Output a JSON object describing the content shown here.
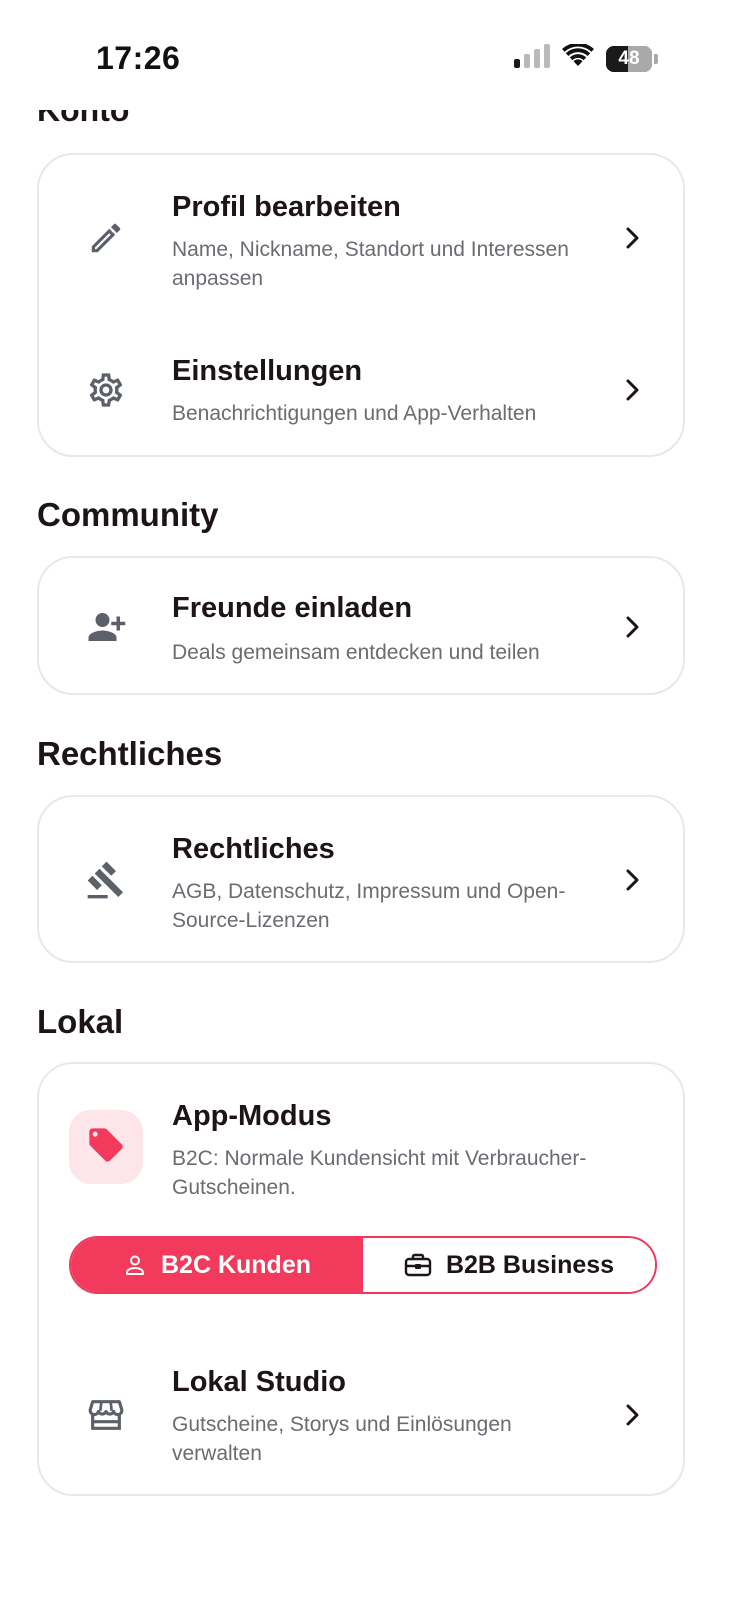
{
  "status_bar": {
    "time": "17:26",
    "battery": "48",
    "icons": [
      "signal-icon",
      "wifi-icon",
      "battery-icon"
    ]
  },
  "colors": {
    "accent": "#f23b5c",
    "accent_soft": "#fde5e9",
    "text_primary": "#1c1416",
    "text_secondary": "#6b6b72",
    "icon_gray": "#5c6068",
    "card_border": "#e8e8ea"
  },
  "konto": {
    "heading_cut": "Konto",
    "items": [
      {
        "icon": "pencil-icon",
        "title": "Profil bearbeiten",
        "subtitle": "Name, Nickname, Standort und Interessen anpassen"
      },
      {
        "icon": "gear-icon",
        "title": "Einstellungen",
        "subtitle": "Benachrichtigungen und App-Verhalten"
      }
    ]
  },
  "community": {
    "heading": "Community",
    "items": [
      {
        "icon": "person-add-icon",
        "title": "Freunde einladen",
        "subtitle": "Deals gemeinsam entdecken und teilen"
      }
    ]
  },
  "rechtliches": {
    "heading": "Rechtliches",
    "items": [
      {
        "icon": "gavel-icon",
        "title": "Rechtliches",
        "subtitle": "AGB, Datenschutz, Impressum und Open-Source-Lizenzen"
      }
    ]
  },
  "lokal": {
    "heading": "Lokal",
    "app_mode": {
      "icon": "tag-icon",
      "title": "App-Modus",
      "subtitle": "B2C: Normale Kundensicht mit Verbraucher-Gutscheinen.",
      "options": [
        {
          "icon": "person-icon",
          "label": "B2C Kunden",
          "selected": true
        },
        {
          "icon": "briefcase-icon",
          "label": "B2B Business",
          "selected": false
        }
      ]
    },
    "studio": {
      "icon": "storefront-icon",
      "title": "Lokal Studio",
      "subtitle": "Gutscheine, Storys und Einlösungen verwalten"
    }
  }
}
